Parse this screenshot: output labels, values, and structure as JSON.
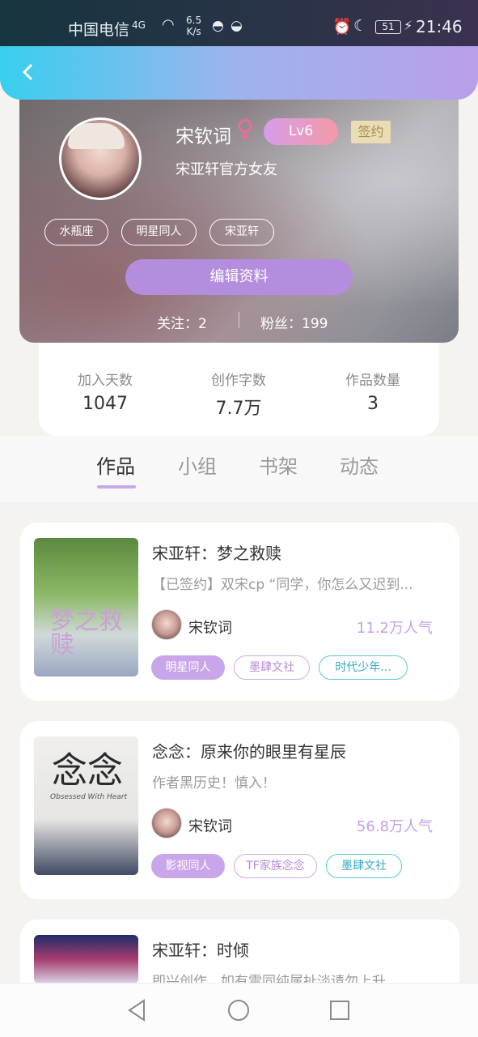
{
  "status_bar": {
    "carrier": "中国电信",
    "signal": "4G",
    "speed_value": "6.5",
    "speed_unit": "K/s",
    "battery": "51",
    "time": "21:46"
  },
  "topbar": {
    "back_icon": "chevron-left-icon"
  },
  "profile": {
    "name": "宋钦词",
    "gender_symbol": "♀",
    "level": "Lv6",
    "signed_badge": "签约",
    "bio": "宋亚轩官方女友",
    "tags": [
      "水瓶座",
      "明星同人",
      "宋亚轩"
    ],
    "edit_button": "编辑资料",
    "follow_label": "关注：",
    "follow_count": "2",
    "fans_label": "粉丝：",
    "fans_count": "199"
  },
  "stats": [
    {
      "label": "加入天数",
      "value": "1047"
    },
    {
      "label": "创作字数",
      "value": "7.7万"
    },
    {
      "label": "作品数量",
      "value": "3"
    }
  ],
  "tabs": [
    "作品",
    "小组",
    "书架",
    "动态"
  ],
  "active_tab": "作品",
  "works": [
    {
      "title": "宋亚轩：梦之救赎",
      "description": "【已签约】双宋cp “同学，你怎么又迟到...",
      "author": "宋钦词",
      "popularity": "11.2万人气",
      "cover_text": "梦之救赎",
      "genres": [
        "明星同人",
        "墨肆文社",
        "时代少年..."
      ]
    },
    {
      "title": "念念：原来你的眼里有星辰",
      "description": "作者黑历史！慎入！",
      "author": "宋钦词",
      "popularity": "56.8万人气",
      "cover_text": "念念",
      "cover_subtitle": "Obsessed With Heart",
      "genres": [
        "影视同人",
        "TF家族念念",
        "墨肆文社"
      ]
    },
    {
      "title": "宋亚轩：时倾",
      "description": "即兴创作，如有雷同纯属扯淡请勿上升",
      "author": "",
      "popularity": "",
      "genres": []
    }
  ],
  "colors": {
    "accent_purple": "#b48ddf",
    "tab_underline": "#c9a8ea",
    "popularity": "#c4a0e6",
    "topbar_start": "#38cfee",
    "topbar_end": "#b99fe9"
  }
}
